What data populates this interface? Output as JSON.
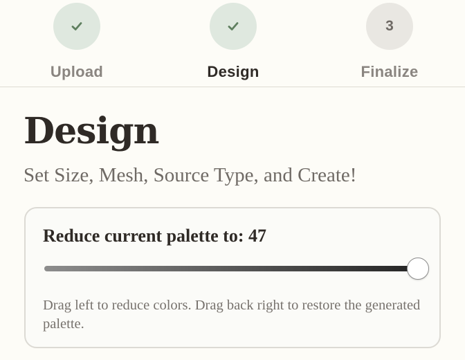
{
  "stepper": {
    "steps": [
      {
        "label": "Upload",
        "status": "complete",
        "icon": "check-icon"
      },
      {
        "label": "Design",
        "status": "complete",
        "icon": "check-icon",
        "active": true
      },
      {
        "label": "Finalize",
        "status": "pending",
        "number": "3"
      }
    ]
  },
  "page": {
    "title": "Design",
    "subtitle": "Set Size, Mesh, Source Type, and Create!"
  },
  "palette_card": {
    "heading": "Reduce current palette to: 47",
    "slider": {
      "value": 47,
      "max": 47,
      "fraction": 1.0
    },
    "help_text": "Drag left to reduce colors. Drag back right to restore the generated palette."
  },
  "colors": {
    "background": "#fdfcf7",
    "check_green": "#5f7f5f",
    "step_done_bg": "#dfe8df",
    "step_pending_bg": "#e9e7e2",
    "text_dark": "#2f2a26",
    "text_muted": "#6f6a65"
  }
}
